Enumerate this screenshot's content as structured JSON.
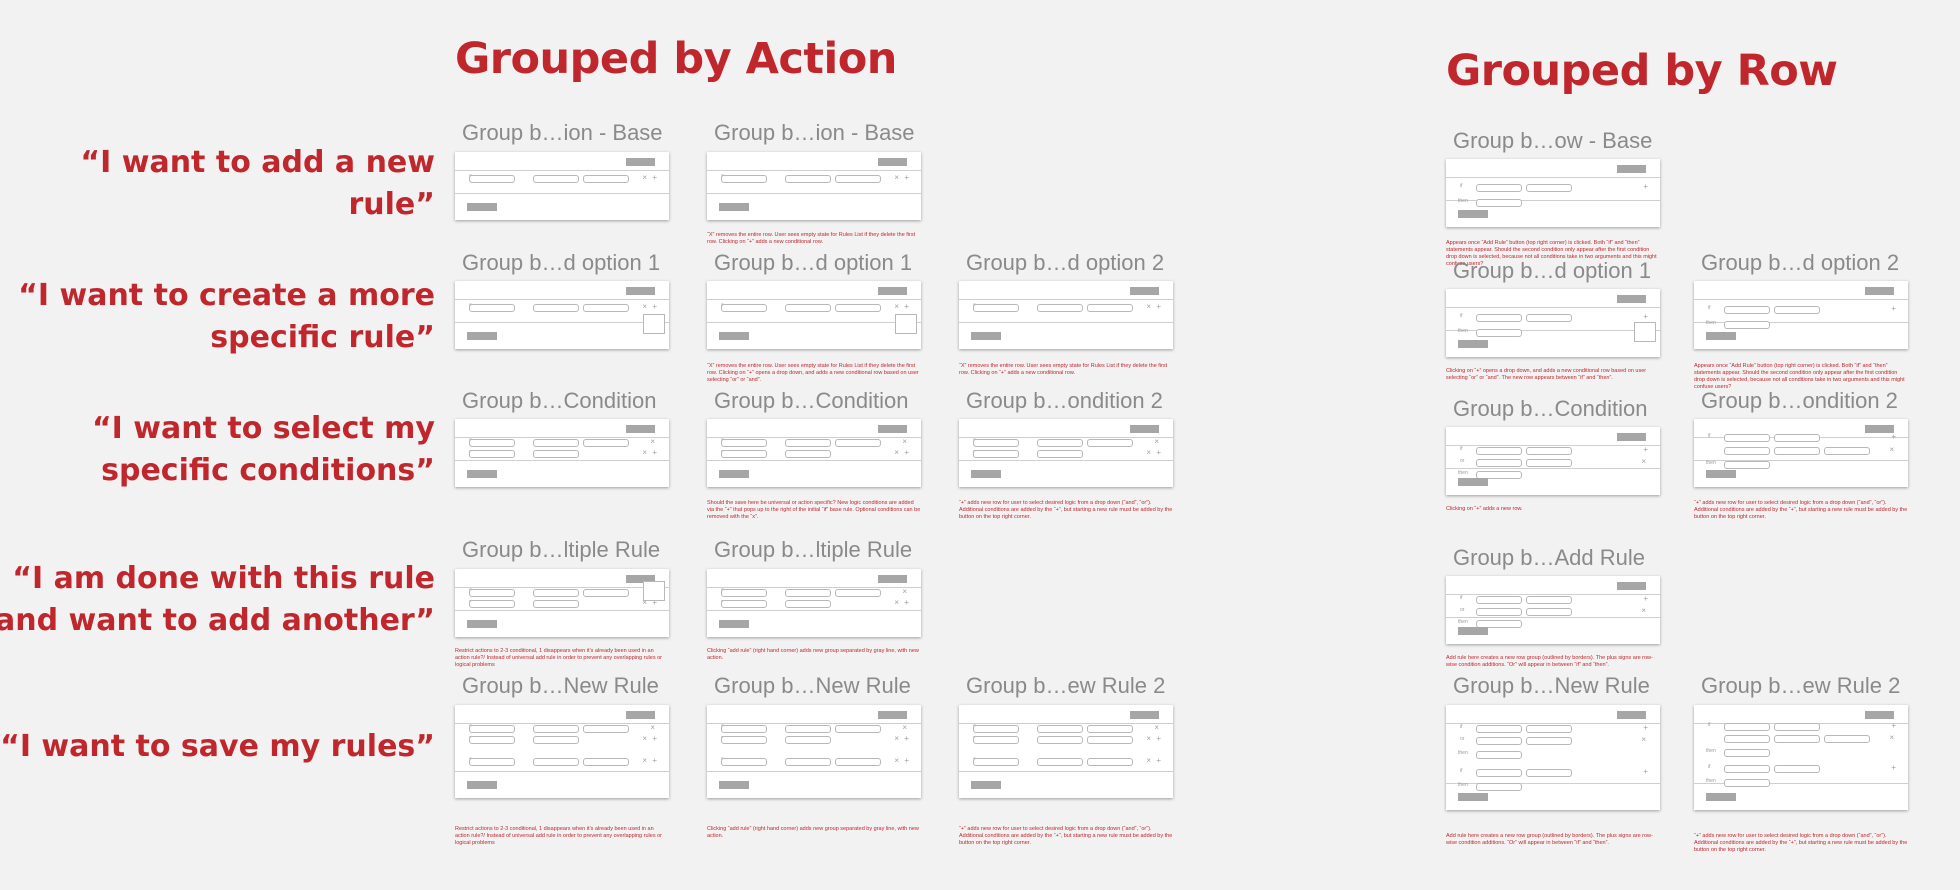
{
  "titles": {
    "left": "Grouped by Action",
    "right": "Grouped by Row"
  },
  "quotes": [
    "“I want to add a new rule”",
    "“I want to create a more specific rule”",
    "“I want to select my specific conditions”",
    "“I am done with this rule and want to add another”",
    "“I want to save my rules”"
  ],
  "cards": [
    {
      "label": "Group b…ion - Base"
    },
    {
      "label": "Group b…ion - Base",
      "note": "“X” removes the entire row. User sees empty state for Rules List if they delete the first row. Clicking on “+” adds a new conditional row."
    },
    {
      "label": "Group b…d option 1"
    },
    {
      "label": "Group b…d option 1",
      "note": "“X” removes the entire row. User sees empty state for Rules List if they delete the first row. Clicking on “+” opens a drop down, and adds a new conditional row based on user selecting “or” or “and”."
    },
    {
      "label": "Group b…d option 2",
      "note": "“X” removes the entire row. User sees empty state for Rules List if they delete the first row. Clicking on “+” adds a new conditional row."
    },
    {
      "label": "Group b…Condition"
    },
    {
      "label": "Group b…Condition",
      "note": "Should the save here be universal or action specific? New logic conditions are added via the “+” that pops up to the right of the initial “if” base rule. Optional conditions can be removed with the “x”."
    },
    {
      "label": "Group b…ondition 2",
      "note": "“+” adds new row for user to select desired logic from a drop down (“and”, “or”). Additional conditions are added by the “+”, but starting a new rule must be added by the button on the top right corner."
    },
    {
      "label": "Group b…ltiple Rule",
      "note": "Restrict actions to 2-3 conditional, 1 disappears when it’s already been used in an action rule?/ Instead of universal add rule in order to prevent any overlapping rules or logical problems"
    },
    {
      "label": "Group b…ltiple Rule",
      "note": "Clicking “add rule” (right hand corner) adds new group separated by gray line, with new action."
    },
    {
      "label": "Group b…New Rule",
      "note": "Restrict actions to 2-3 conditional, 1 disappears when it’s already been used in an action rule?/ Instead of universal add rule in order to prevent any overlapping rules or logical problems"
    },
    {
      "label": "Group b…New Rule",
      "note": "Clicking “add rule” (right hand corner) adds new group separated by gray line, with new action."
    },
    {
      "label": "Group b…ew Rule 2",
      "note": "“+” adds new row for user to select desired logic from a drop down (“and”, “or”). Additional conditions are added by the “+”, but starting a new rule must be added by the button on the top right corner."
    },
    {
      "label": "Group b…ow - Base",
      "note": "Appears once “Add Rule” button (top right corner) is clicked. Both “if” and “then” statements appear. Should the second condition only appear after the first condition drop down is selected, because not all conditions take in two arguments and this might confuse users?"
    },
    {
      "label": "Group b…d option 1",
      "note": "Clicking on “+” opens a drop down, and adds a new conditional row based on user selecting “or” or “and”. The new row appears between “if” and “then”."
    },
    {
      "label": "Group b…d option 2",
      "note": "Appears once “Add Rule” button (top right corner) is clicked. Both “if” and “then” statements appear. Should the second condition only appear after the first condition drop down is selected, because not all conditions take in two arguments and this might confuse users?"
    },
    {
      "label": "Group b…Condition",
      "note": "Clicking on “+” adds a new row."
    },
    {
      "label": "Group b…ondition 2",
      "note": "“+” adds new row for user to select desired logic from a drop down (“and”, “or”). Additional conditions are added by the “+”, but starting a new rule must be added by the button on the top right corner."
    },
    {
      "label": "Group b…Add Rule",
      "note": "Add rule here creates a new row group (outlined by borders). The plus signs are row-wise condition additions. “Or” will appear in between “if” and “then”."
    },
    {
      "label": "Group b…New Rule",
      "note": "Add rule here creates a new row group (outlined by borders). The plus signs are row-wise condition additions. “Or” will appear in between “if” and “then”."
    },
    {
      "label": "Group b…ew Rule 2",
      "note": "“+” adds new row for user to select desired logic from a drop down (“and”, “or”). Additional conditions are added by the “+”, but starting a new rule must be added by the button on the top right corner."
    }
  ],
  "mock_text": {
    "if": "if",
    "or": "or",
    "then": "then",
    "plus": "+",
    "close": "×"
  },
  "colors": {
    "accent": "#c0272d",
    "label_gray": "#8a8a8a",
    "background": "#f2f2f2"
  }
}
